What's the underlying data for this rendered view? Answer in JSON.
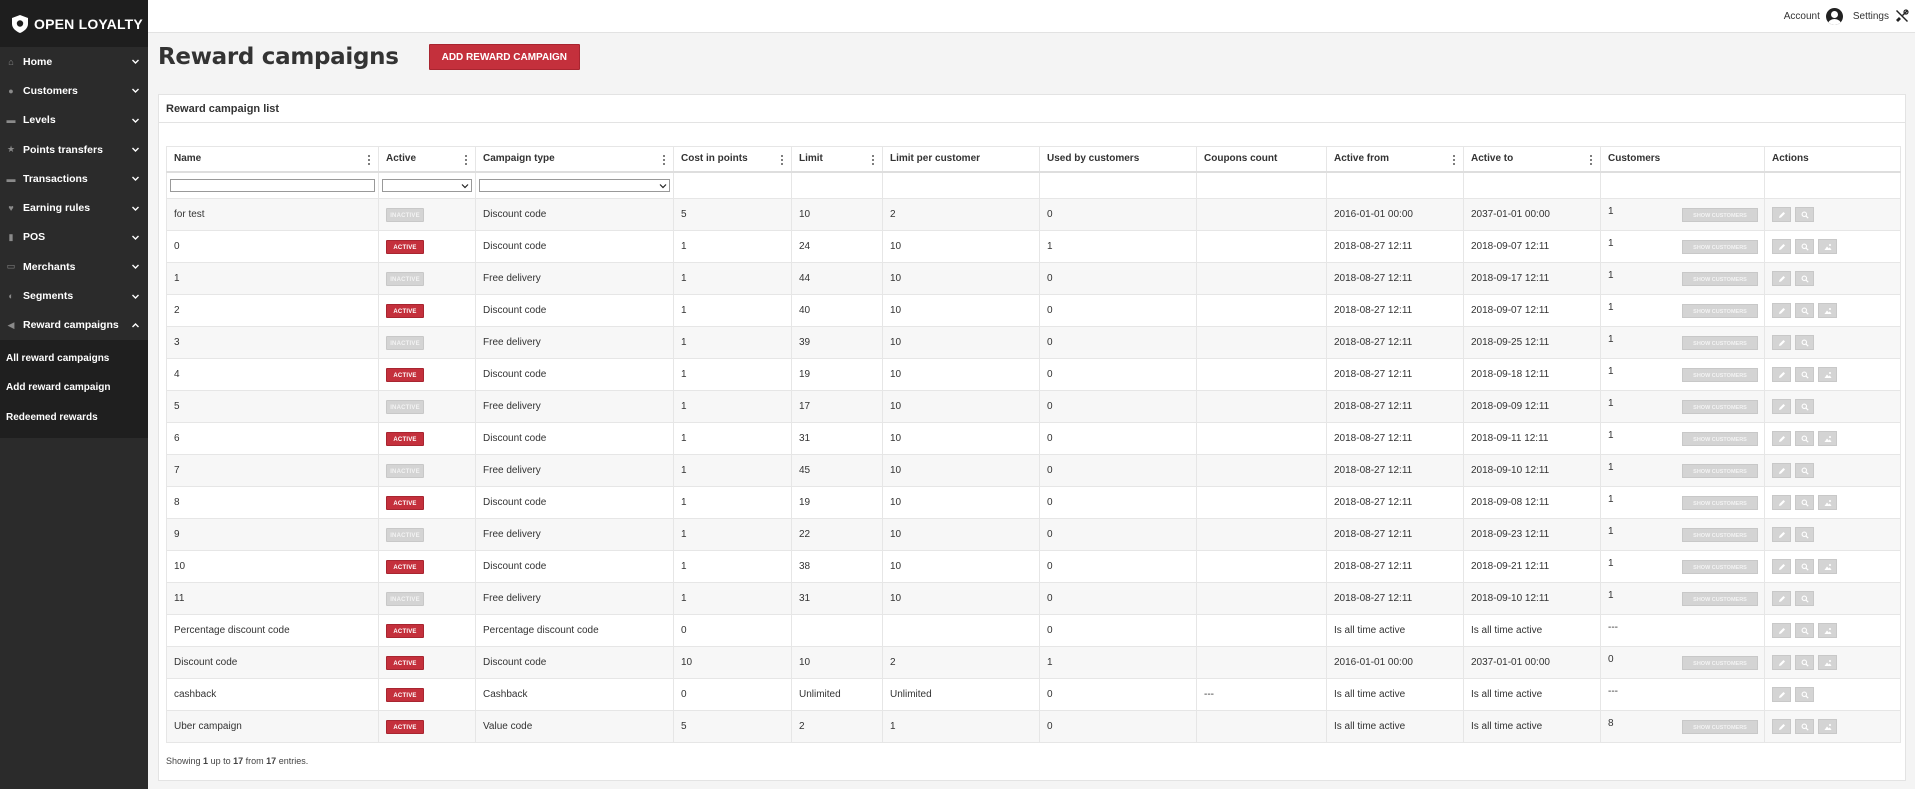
{
  "app": {
    "logo_text": "OPEN LOYALTY"
  },
  "sidebar": {
    "items": [
      {
        "label": "Home",
        "icon": "home-icon",
        "glyph": "⌂"
      },
      {
        "label": "Customers",
        "icon": "users-icon",
        "glyph": "●"
      },
      {
        "label": "Levels",
        "icon": "levels-icon",
        "glyph": "▬"
      },
      {
        "label": "Points transfers",
        "icon": "star-icon",
        "glyph": "★"
      },
      {
        "label": "Transactions",
        "icon": "cart-icon",
        "glyph": "▬"
      },
      {
        "label": "Earning rules",
        "icon": "heart-icon",
        "glyph": "♥"
      },
      {
        "label": "POS",
        "icon": "pos-icon",
        "glyph": "▮"
      },
      {
        "label": "Merchants",
        "icon": "merchant-icon",
        "glyph": "▭"
      },
      {
        "label": "Segments",
        "icon": "segments-icon",
        "glyph": "◐"
      },
      {
        "label": "Reward campaigns",
        "icon": "trophy-icon",
        "glyph": "◀"
      }
    ],
    "subitems": [
      {
        "label": "All reward campaigns"
      },
      {
        "label": "Add reward campaign"
      },
      {
        "label": "Redeemed rewards"
      }
    ]
  },
  "topbar": {
    "account_label": "Account",
    "settings_label": "Settings"
  },
  "header": {
    "title": "Reward campaigns",
    "add_button": "ADD REWARD CAMPAIGN"
  },
  "panel": {
    "title": "Reward campaign list"
  },
  "table": {
    "columns": [
      {
        "label": "Name",
        "sortable": true
      },
      {
        "label": "Active",
        "sortable": true
      },
      {
        "label": "Campaign type",
        "sortable": true
      },
      {
        "label": "Cost in points",
        "sortable": true
      },
      {
        "label": "Limit",
        "sortable": true
      },
      {
        "label": "Limit per customer",
        "sortable": false
      },
      {
        "label": "Used by customers",
        "sortable": false
      },
      {
        "label": "Coupons count",
        "sortable": false
      },
      {
        "label": "Active from",
        "sortable": true
      },
      {
        "label": "Active to",
        "sortable": true
      },
      {
        "label": "Customers",
        "sortable": false
      },
      {
        "label": "Actions",
        "sortable": false
      }
    ],
    "active_label": "ACTIVE",
    "inactive_label": "INACTIVE",
    "show_customers_label": "SHOW CUSTOMERS",
    "rows": [
      {
        "name": "for test",
        "active": false,
        "type": "Discount code",
        "cost": "5",
        "limit": "10",
        "limit_per": "2",
        "used": "0",
        "coupons": "",
        "from": "2016-01-01 00:00",
        "to": "2037-01-01 00:00",
        "customers": "1",
        "show_btn": true,
        "actions": 2
      },
      {
        "name": "0",
        "active": true,
        "type": "Discount code",
        "cost": "1",
        "limit": "24",
        "limit_per": "10",
        "used": "1",
        "coupons": "",
        "from": "2018-08-27 12:11",
        "to": "2018-09-07 12:11",
        "customers": "1",
        "show_btn": true,
        "actions": 3
      },
      {
        "name": "1",
        "active": false,
        "type": "Free delivery",
        "cost": "1",
        "limit": "44",
        "limit_per": "10",
        "used": "0",
        "coupons": "",
        "from": "2018-08-27 12:11",
        "to": "2018-09-17 12:11",
        "customers": "1",
        "show_btn": true,
        "actions": 2
      },
      {
        "name": "2",
        "active": true,
        "type": "Discount code",
        "cost": "1",
        "limit": "40",
        "limit_per": "10",
        "used": "0",
        "coupons": "",
        "from": "2018-08-27 12:11",
        "to": "2018-09-07 12:11",
        "customers": "1",
        "show_btn": true,
        "actions": 3
      },
      {
        "name": "3",
        "active": false,
        "type": "Free delivery",
        "cost": "1",
        "limit": "39",
        "limit_per": "10",
        "used": "0",
        "coupons": "",
        "from": "2018-08-27 12:11",
        "to": "2018-09-25 12:11",
        "customers": "1",
        "show_btn": true,
        "actions": 2
      },
      {
        "name": "4",
        "active": true,
        "type": "Discount code",
        "cost": "1",
        "limit": "19",
        "limit_per": "10",
        "used": "0",
        "coupons": "",
        "from": "2018-08-27 12:11",
        "to": "2018-09-18 12:11",
        "customers": "1",
        "show_btn": true,
        "actions": 3
      },
      {
        "name": "5",
        "active": false,
        "type": "Free delivery",
        "cost": "1",
        "limit": "17",
        "limit_per": "10",
        "used": "0",
        "coupons": "",
        "from": "2018-08-27 12:11",
        "to": "2018-09-09 12:11",
        "customers": "1",
        "show_btn": true,
        "actions": 2
      },
      {
        "name": "6",
        "active": true,
        "type": "Discount code",
        "cost": "1",
        "limit": "31",
        "limit_per": "10",
        "used": "0",
        "coupons": "",
        "from": "2018-08-27 12:11",
        "to": "2018-09-11 12:11",
        "customers": "1",
        "show_btn": true,
        "actions": 3
      },
      {
        "name": "7",
        "active": false,
        "type": "Free delivery",
        "cost": "1",
        "limit": "45",
        "limit_per": "10",
        "used": "0",
        "coupons": "",
        "from": "2018-08-27 12:11",
        "to": "2018-09-10 12:11",
        "customers": "1",
        "show_btn": true,
        "actions": 2
      },
      {
        "name": "8",
        "active": true,
        "type": "Discount code",
        "cost": "1",
        "limit": "19",
        "limit_per": "10",
        "used": "0",
        "coupons": "",
        "from": "2018-08-27 12:11",
        "to": "2018-09-08 12:11",
        "customers": "1",
        "show_btn": true,
        "actions": 3
      },
      {
        "name": "9",
        "active": false,
        "type": "Free delivery",
        "cost": "1",
        "limit": "22",
        "limit_per": "10",
        "used": "0",
        "coupons": "",
        "from": "2018-08-27 12:11",
        "to": "2018-09-23 12:11",
        "customers": "1",
        "show_btn": true,
        "actions": 2
      },
      {
        "name": "10",
        "active": true,
        "type": "Discount code",
        "cost": "1",
        "limit": "38",
        "limit_per": "10",
        "used": "0",
        "coupons": "",
        "from": "2018-08-27 12:11",
        "to": "2018-09-21 12:11",
        "customers": "1",
        "show_btn": true,
        "actions": 3
      },
      {
        "name": "11",
        "active": false,
        "type": "Free delivery",
        "cost": "1",
        "limit": "31",
        "limit_per": "10",
        "used": "0",
        "coupons": "",
        "from": "2018-08-27 12:11",
        "to": "2018-09-10 12:11",
        "customers": "1",
        "show_btn": true,
        "actions": 2
      },
      {
        "name": "Percentage discount code",
        "active": true,
        "type": "Percentage discount code",
        "cost": "0",
        "limit": "",
        "limit_per": "",
        "used": "0",
        "coupons": "",
        "from": "Is all time active",
        "to": "Is all time active",
        "customers": "---",
        "show_btn": false,
        "actions": 3
      },
      {
        "name": "Discount code",
        "active": true,
        "type": "Discount code",
        "cost": "10",
        "limit": "10",
        "limit_per": "2",
        "used": "1",
        "coupons": "",
        "from": "2016-01-01 00:00",
        "to": "2037-01-01 00:00",
        "customers": "0",
        "show_btn": true,
        "actions": 3
      },
      {
        "name": "cashback",
        "active": true,
        "type": "Cashback",
        "cost": "0",
        "limit": "Unlimited",
        "limit_per": "Unlimited",
        "used": "0",
        "coupons": "---",
        "from": "Is all time active",
        "to": "Is all time active",
        "customers": "---",
        "show_btn": false,
        "actions": 2
      },
      {
        "name": "Uber campaign",
        "active": true,
        "type": "Value code",
        "cost": "5",
        "limit": "2",
        "limit_per": "1",
        "used": "0",
        "coupons": "",
        "from": "Is all time active",
        "to": "Is all time active",
        "customers": "8",
        "show_btn": true,
        "actions": 3
      }
    ]
  },
  "footer": {
    "prefix": "Showing",
    "from": "1",
    "mid1": "up to",
    "to": "17",
    "mid2": "from",
    "total": "17",
    "suffix": "entries."
  },
  "colors": {
    "accent": "#c4303c",
    "sidebar_bg": "#2b2b2b",
    "number_green": "#2a7a3a"
  }
}
